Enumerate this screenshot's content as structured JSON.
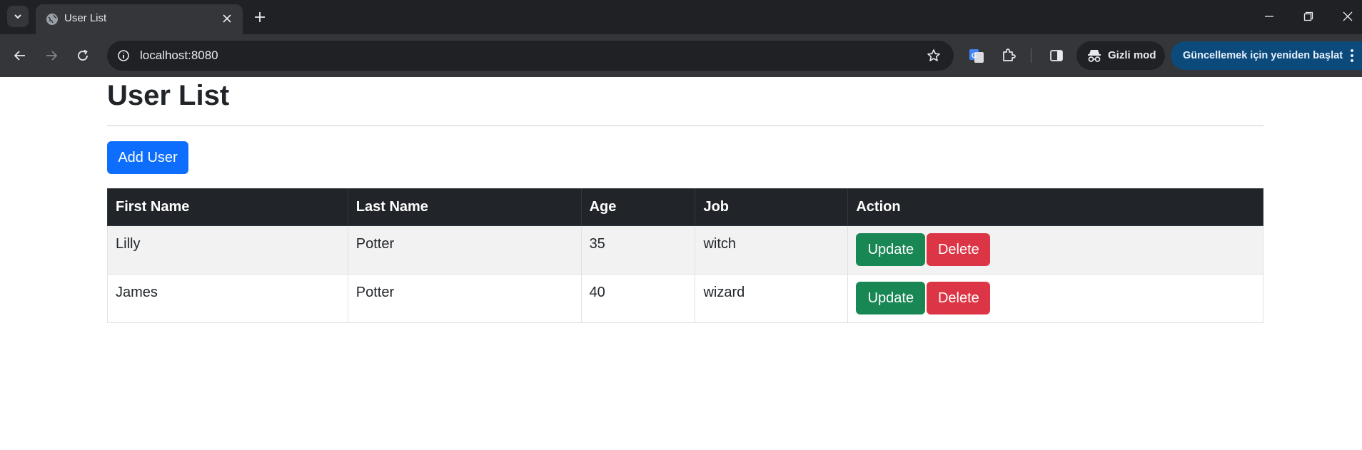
{
  "browser": {
    "tab_title": "User List",
    "url": "localhost:8080",
    "incognito_label": "Gizli mod",
    "relaunch_label": "Güncellemek için yeniden başlat"
  },
  "page": {
    "title": "User List",
    "add_button": "Add User",
    "table": {
      "headers": [
        "First Name",
        "Last Name",
        "Age",
        "Job",
        "Action"
      ],
      "rows": [
        {
          "first_name": "Lilly",
          "last_name": "Potter",
          "age": "35",
          "job": "witch"
        },
        {
          "first_name": "James",
          "last_name": "Potter",
          "age": "40",
          "job": "wizard"
        }
      ],
      "update_label": "Update",
      "delete_label": "Delete"
    }
  },
  "colors": {
    "primary": "#0d6efd",
    "success": "#198754",
    "danger": "#dc3545",
    "table_header": "#212529"
  }
}
